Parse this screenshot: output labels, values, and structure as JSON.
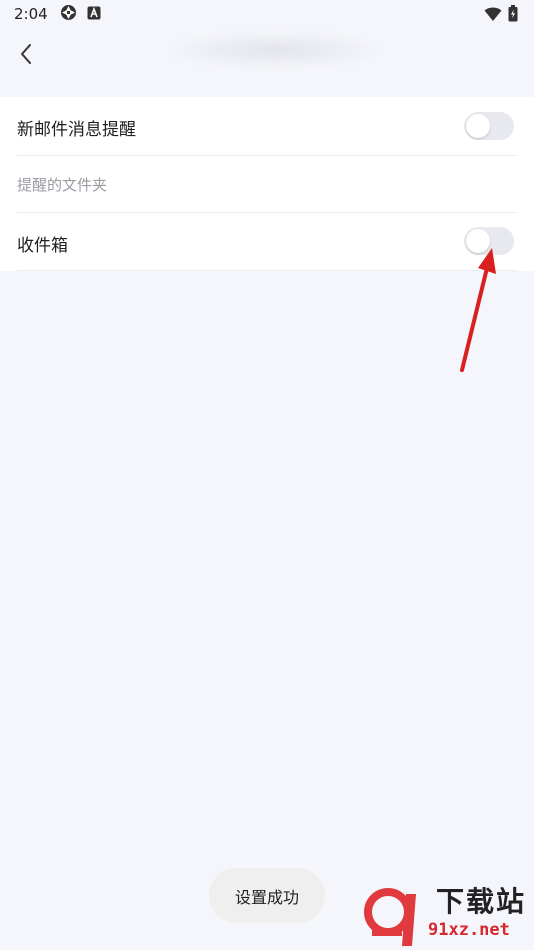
{
  "status_bar": {
    "time": "2:04"
  },
  "settings": {
    "new_mail_alert": {
      "label": "新邮件消息提醒",
      "enabled": false
    },
    "section_header": "提醒的文件夹",
    "inbox": {
      "label": "收件箱",
      "enabled": false
    }
  },
  "toast": {
    "message": "设置成功"
  },
  "watermark": {
    "title": "下载站",
    "url": "91xz.net"
  },
  "colors": {
    "background": "#f5f6fb",
    "card": "#ffffff",
    "toggle_off": "#e8e9ee",
    "annotation_arrow": "#d91f1f"
  }
}
